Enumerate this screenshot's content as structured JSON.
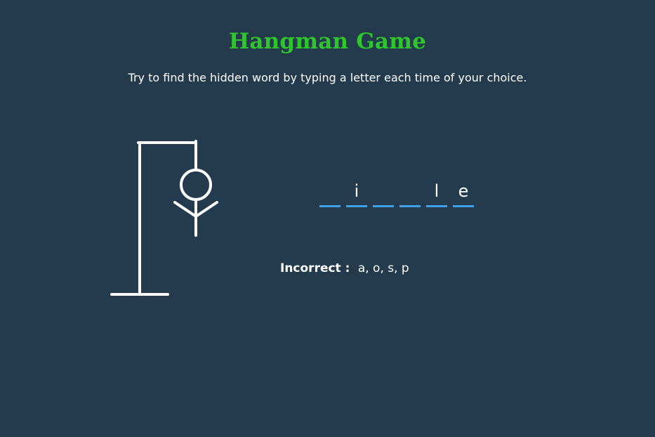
{
  "colors": {
    "background": "#233b4c",
    "title": "#2ec62c",
    "text": "#ffffff",
    "underline": "#3fa1e8",
    "figure": "#ffffff"
  },
  "header": {
    "title": "Hangman Game",
    "instructions": "Try to find the hidden word by typing a letter each time of your choice."
  },
  "game": {
    "word_slots": [
      {
        "letter": ""
      },
      {
        "letter": "i"
      },
      {
        "letter": ""
      },
      {
        "letter": ""
      },
      {
        "letter": "l"
      },
      {
        "letter": "e"
      }
    ],
    "incorrect": {
      "label": "Incorrect :",
      "letters": "a, o, s, p"
    },
    "figure": {
      "wrong_guesses_drawn": 4,
      "parts_visible": [
        "head",
        "body",
        "left-arm",
        "right-arm"
      ]
    }
  }
}
